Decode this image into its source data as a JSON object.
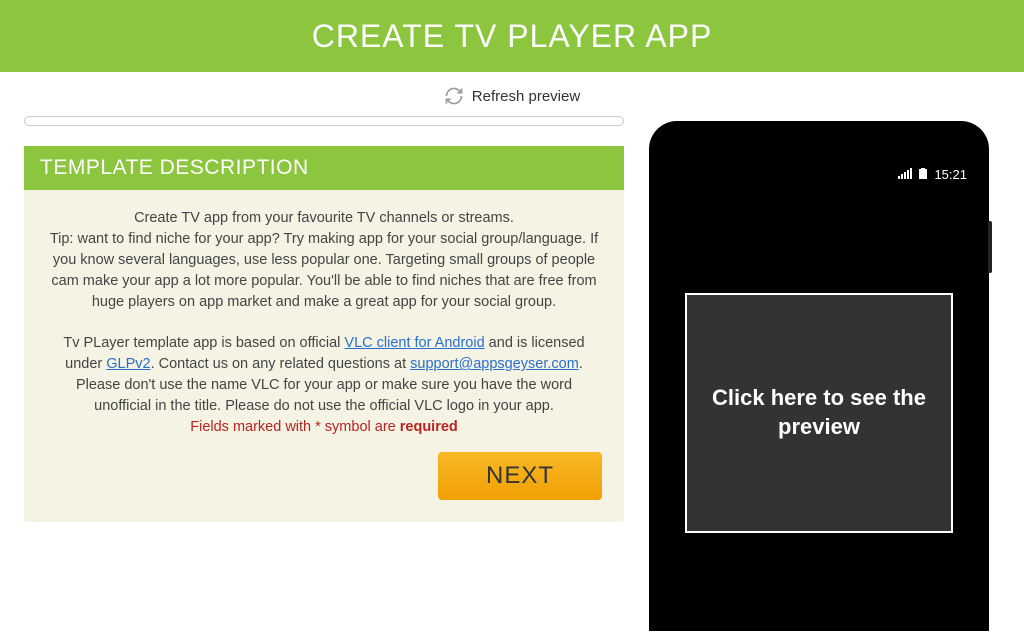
{
  "header": {
    "title": "CREATE TV PLAYER APP"
  },
  "refresh": {
    "label": "Refresh preview"
  },
  "card": {
    "header_title": "TEMPLATE DESCRIPTION",
    "para1": "Create TV app from your favourite TV channels or streams.\nTip: want to find niche for your app? Try making app for your social group/language. If you know several languages, use less popular one. Targeting small groups of people cam make your app a lot more popular. You'll be able to find niches that are free from huge players on app market and make a great app for your social group.",
    "para2_pre": "Tv PLayer template app is based on official ",
    "link_vlc": "VLC client for Android",
    "para2_mid1": " and is licensed under ",
    "link_glp": "GLPv2",
    "para2_mid2": ". Contact us on any related questions at ",
    "link_email": "support@appsgeyser.com",
    "para2_post": ". Please don't use the name VLC for your app or make sure you have the word unofficial in the title. Please do not use the official VLC logo in your app.",
    "required_pre": "Fields marked with * symbol are ",
    "required_strong": "required",
    "next_label": "NEXT"
  },
  "phone": {
    "status_time": "15:21",
    "preview_text": "Click here to see the preview"
  }
}
